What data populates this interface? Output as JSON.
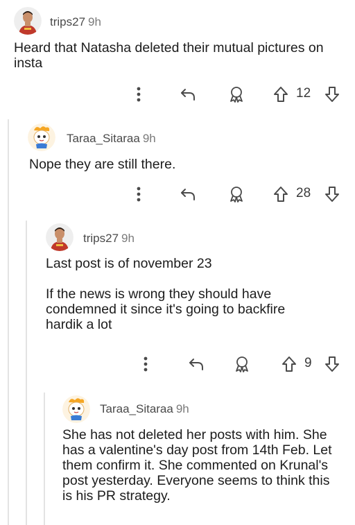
{
  "comments": [
    {
      "author": "trips27",
      "time": "9h",
      "avatar": "cricketer-avatar",
      "body": [
        "Heard that Natasha deleted their mutual pictures on insta"
      ],
      "votes": "12"
    },
    {
      "author": "Taraa_Sitaraa",
      "time": "9h",
      "avatar": "cartoon-avatar",
      "body": [
        "Nope they are still there."
      ],
      "votes": "28"
    },
    {
      "author": "trips27",
      "time": "9h",
      "avatar": "cricketer-avatar",
      "body": [
        "Last post is of november 23",
        "If the news is wrong they should have condemned it since it's going to backfire hardik a lot"
      ],
      "votes": "9"
    },
    {
      "author": "Taraa_Sitaraa",
      "time": "9h",
      "avatar": "cartoon-avatar",
      "body": [
        "She has not deleted her posts with him. She has a valentine's day post from 14th Feb. Let them confirm it. She commented on Krunal's post yesterday. Everyone seems to think this is his PR strategy."
      ],
      "votes": ""
    }
  ],
  "icons": {
    "more": "more-options-icon",
    "reply": "reply-icon",
    "award": "award-icon",
    "upvote": "upvote-arrow-icon",
    "downvote": "downvote-arrow-icon"
  }
}
